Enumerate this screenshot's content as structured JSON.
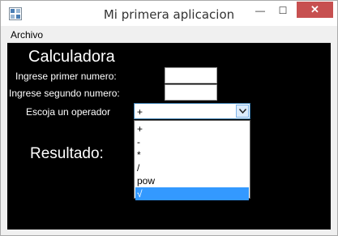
{
  "window": {
    "title": "Mi primera aplicacion",
    "icon": "app-icon",
    "minimize_glyph": "—",
    "maximize_glyph": "☐",
    "close_glyph": "✕"
  },
  "menubar": {
    "items": [
      {
        "label": "Archivo"
      }
    ]
  },
  "form": {
    "heading": "Calculadora",
    "first_number_label": "Ingrese primer numero:",
    "first_number_value": "",
    "second_number_label": "Ingrese segundo numero:",
    "second_number_value": "",
    "operator_label": "Escoja un operador",
    "operator_selected": "+",
    "result_label": "Resultado:"
  },
  "dropdown": {
    "options": [
      {
        "label": "+",
        "selected": false
      },
      {
        "label": "-",
        "selected": false
      },
      {
        "label": "*",
        "selected": false
      },
      {
        "label": "/",
        "selected": false
      },
      {
        "label": "pow",
        "selected": false
      },
      {
        "label": "√",
        "selected": true
      }
    ]
  },
  "colors": {
    "content_bg": "#000000",
    "selection": "#3399ff",
    "close_button": "#c75050"
  }
}
